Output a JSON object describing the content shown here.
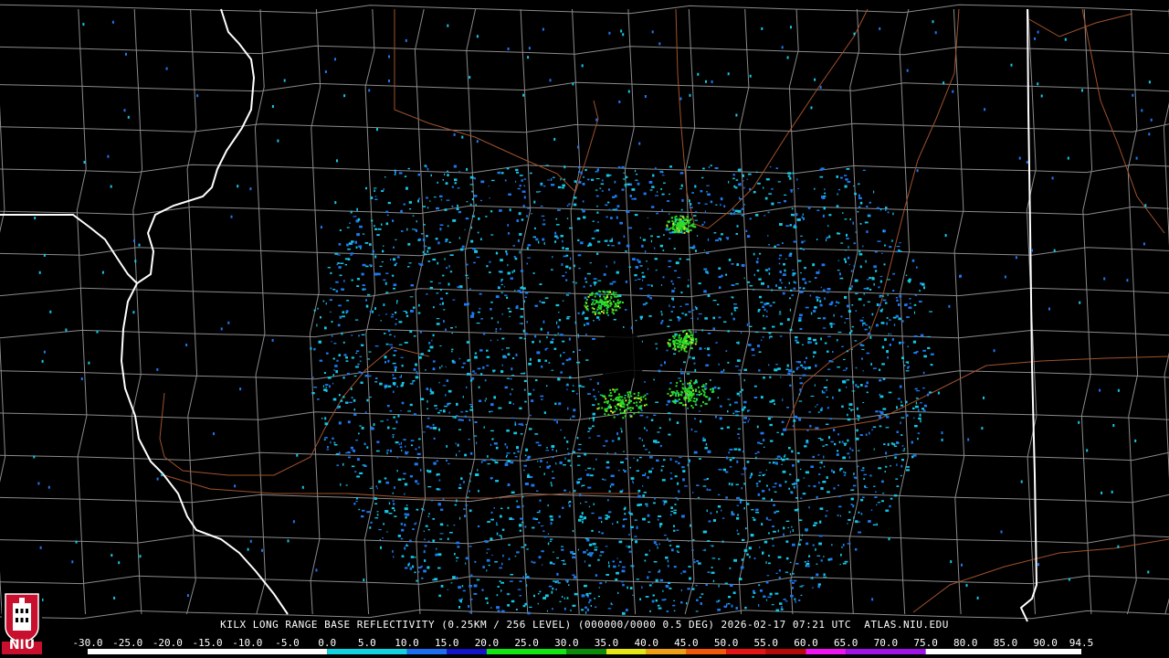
{
  "caption": "KILX LONG RANGE BASE REFLECTIVITY (0.25KM / 256 LEVEL) (000000/0000 0.5 DEG) 2026-02-17 07:21 UTC  ATLAS.NIU.EDU",
  "logo": {
    "text": "NIU",
    "colors": {
      "red": "#c8102e",
      "black": "#000000",
      "white": "#ffffff"
    }
  },
  "scale": {
    "ticks": [
      "-30.0",
      "-25.0",
      "-20.0",
      "-15.0",
      "-10.0",
      "-5.0",
      "0.0",
      "5.0",
      "10.0",
      "15.0",
      "20.0",
      "25.0",
      "30.0",
      "35.0",
      "40.0",
      "45.0",
      "50.0",
      "55.0",
      "60.0",
      "65.0",
      "70.0",
      "75.0",
      "80.0",
      "85.0",
      "90.0",
      "94.5"
    ],
    "colors": [
      {
        "from": -30,
        "color": "#ffffff"
      },
      {
        "from": 0,
        "color": "#14d2e0"
      },
      {
        "from": 10,
        "color": "#1e6ef0"
      },
      {
        "from": 15,
        "color": "#1414c8"
      },
      {
        "from": 20,
        "color": "#14e614"
      },
      {
        "from": 30,
        "color": "#0a8c0a"
      },
      {
        "from": 35,
        "color": "#e6e614"
      },
      {
        "from": 40,
        "color": "#f0a014"
      },
      {
        "from": 45,
        "color": "#f05a0a"
      },
      {
        "from": 50,
        "color": "#e61414"
      },
      {
        "from": 55,
        "color": "#b40a0a"
      },
      {
        "from": 60,
        "color": "#f014f0"
      },
      {
        "from": 65,
        "color": "#a014e6"
      },
      {
        "from": 75,
        "color": "#ffffff"
      }
    ]
  },
  "colors": {
    "background": "#000000",
    "county_lines": "#8a8a8a",
    "state_lines": "#ffffff",
    "rivers": "#a0522d",
    "echo_light": "#14c8e6",
    "echo_mid": "#1e78f0",
    "echo_green": "#28dc28",
    "echo_yellow": "#e6e628"
  }
}
